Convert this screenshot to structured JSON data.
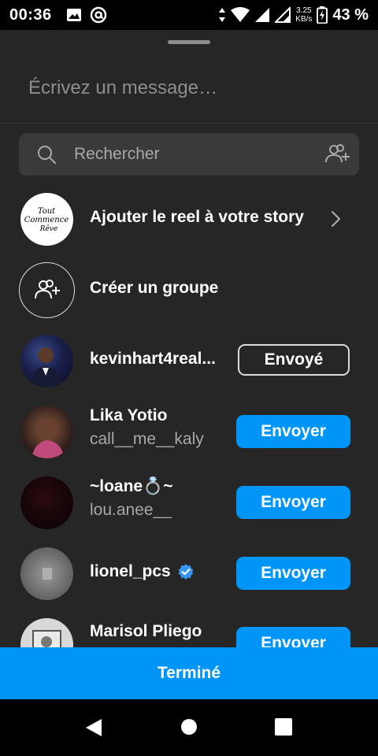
{
  "status_bar": {
    "time": "00:36",
    "speed_value": "3.25",
    "speed_unit": "KB/s",
    "battery": "43 %"
  },
  "composer": {
    "placeholder": "Écrivez un message…"
  },
  "search": {
    "placeholder": "Rechercher"
  },
  "actions": {
    "add_to_story": "Ajouter le reel à votre story",
    "create_group": "Créer un groupe",
    "story_avatar_text": [
      "Tout",
      "Commence",
      "Rêve"
    ]
  },
  "contacts": [
    {
      "name": "kevinhart4real...",
      "username": "",
      "button": "Envoyé",
      "state": "sent"
    },
    {
      "name": "Lika Yotio",
      "username": "call__me__kaly",
      "button": "Envoyer",
      "state": "default"
    },
    {
      "name": "~loane💍~",
      "username": "lou.anee__",
      "button": "Envoyer",
      "state": "default"
    },
    {
      "name": "lionel_pcs",
      "username": "",
      "button": "Envoyer",
      "state": "default",
      "verified": true
    },
    {
      "name": "Marisol Pliego",
      "username": "",
      "button": "Envoyer",
      "state": "default"
    }
  ],
  "footer": {
    "done_label": "Terminé"
  },
  "colors": {
    "accent": "#0095f6",
    "background": "#262626",
    "verified": "#3797f0"
  }
}
